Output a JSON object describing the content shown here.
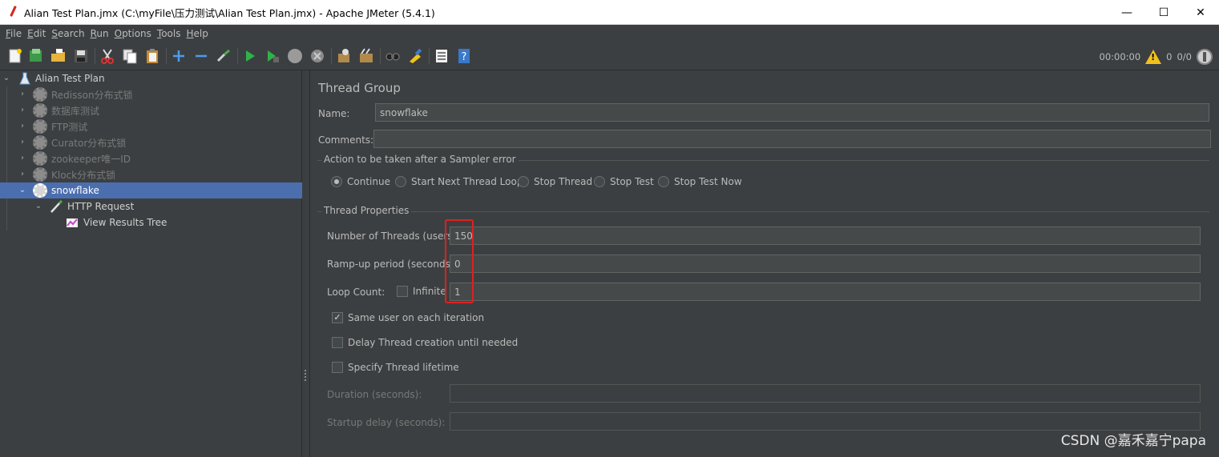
{
  "window": {
    "title": "Alian Test Plan.jmx (C:\\myFile\\压力测试\\Alian Test Plan.jmx) - Apache JMeter (5.4.1)",
    "controls": [
      "—",
      "☐",
      "✕"
    ]
  },
  "menu": [
    {
      "u": "F",
      "rest": "ile"
    },
    {
      "u": "E",
      "rest": "dit"
    },
    {
      "u": "S",
      "rest": "earch"
    },
    {
      "u": "R",
      "rest": "un"
    },
    {
      "u": "O",
      "rest": "ptions"
    },
    {
      "u": "T",
      "rest": "ools"
    },
    {
      "u": "H",
      "rest": "elp"
    }
  ],
  "toolbar_icons": [
    "new-icon",
    "templates-icon",
    "open-icon",
    "save-icon",
    "cut-icon",
    "copy-icon",
    "paste-icon",
    "expand-icon",
    "collapse-icon",
    "toggle-icon",
    "start-icon",
    "start-no-pause-icon",
    "stop-icon",
    "shutdown-icon",
    "clear-icon",
    "clear-all-icon",
    "search-icon",
    "reset-search-icon",
    "function-helper-icon",
    "help-icon"
  ],
  "status": {
    "timer": "00:00:00",
    "warnings": "0",
    "threads": "0/0"
  },
  "tree": {
    "root": "Alian Test Plan",
    "items": [
      {
        "label": "Redisson分布式锁",
        "enabled": false
      },
      {
        "label": "数据库测试",
        "enabled": false
      },
      {
        "label": "FTP测试",
        "enabled": false
      },
      {
        "label": "Curator分布式锁",
        "enabled": false
      },
      {
        "label": "zookeeper唯一ID",
        "enabled": false
      },
      {
        "label": "Klock分布式锁",
        "enabled": false
      },
      {
        "label": "snowflake",
        "enabled": true,
        "selected": true
      }
    ],
    "sampler": "HTTP Request",
    "listener": "View Results Tree"
  },
  "thread_group": {
    "title": "Thread Group",
    "name_label": "Name:",
    "name_value": "snowflake",
    "comments_label": "Comments:",
    "comments_value": "",
    "error_group_title": "Action to be taken after a Sampler error",
    "error_options": [
      "Continue",
      "Start Next Thread Loop",
      "Stop Thread",
      "Stop Test",
      "Stop Test Now"
    ],
    "error_selected": "Continue",
    "props_title": "Thread Properties",
    "threads_label": "Number of Threads (users):",
    "threads_value": "150",
    "rampup_label": "Ramp-up period (seconds):",
    "rampup_value": "0",
    "loop_label": "Loop Count:",
    "infinite_label": "Infinite",
    "infinite_checked": false,
    "loop_value": "1",
    "same_user_label": "Same user on each iteration",
    "same_user_checked": true,
    "delay_label": "Delay Thread creation until needed",
    "delay_checked": false,
    "lifetime_label": "Specify Thread lifetime",
    "lifetime_checked": false,
    "duration_label": "Duration (seconds):",
    "duration_value": "",
    "startup_label": "Startup delay (seconds):",
    "startup_value": ""
  },
  "watermark": "CSDN @嘉禾嘉宁papa"
}
